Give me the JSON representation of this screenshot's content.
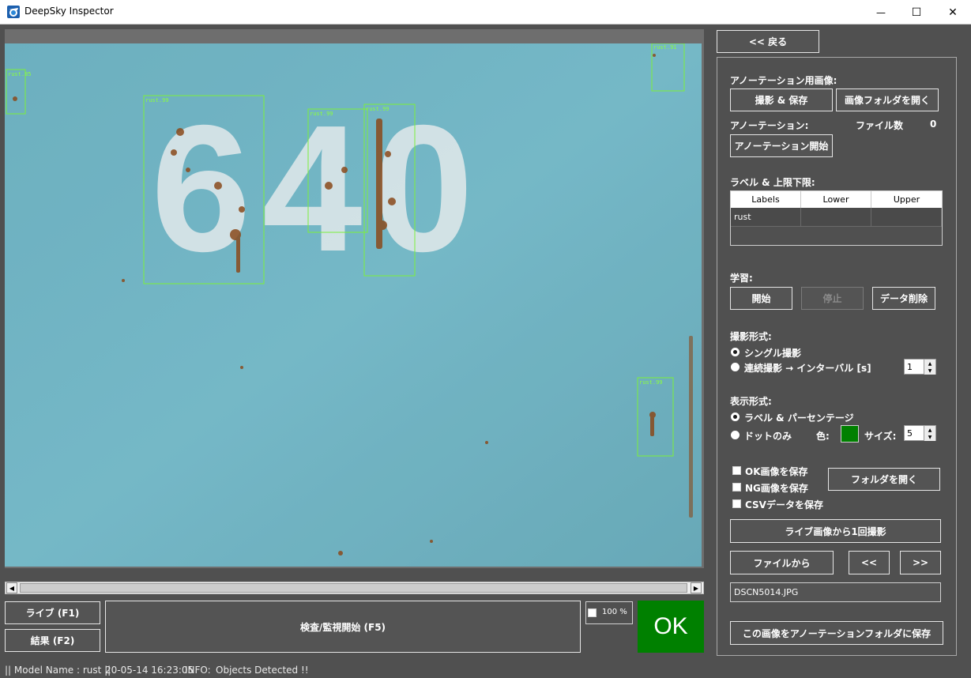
{
  "window": {
    "title": "DeepSky Inspector",
    "minimize_glyph": "—",
    "maximize_glyph": "☐",
    "close_glyph": "✕"
  },
  "viewer": {
    "stencil_number": "640",
    "detections": [
      {
        "label": "rust.85"
      },
      {
        "label": "rust.99"
      },
      {
        "label": "rust.99"
      },
      {
        "label": "rust.99"
      },
      {
        "label": "rust.91"
      },
      {
        "label": "rust.99"
      }
    ]
  },
  "scrollbar": {
    "left_arrow": "◀",
    "right_arrow": "▶"
  },
  "bottom": {
    "live_button": "ライブ (F1)",
    "result_button": "結果 (F2)",
    "start_inspection_button": "検査/監視開始 (F5)",
    "zoom_label": "100 %",
    "status_result": "OK",
    "status_color": "#008000"
  },
  "panel": {
    "back_button": "<< 戻る",
    "annotation_image_heading": "アノーテーション用画像:",
    "capture_save_button": "撮影 & 保存",
    "open_image_folder_button": "画像フォルダを開く",
    "annotation_heading": "アノーテーション:",
    "file_count_label": "ファイル数",
    "file_count_value": "0",
    "start_annotation_button": "アノーテーション開始",
    "label_limits_heading": "ラベル & 上限下限:",
    "table_headers": [
      "Labels",
      "Lower",
      "Upper"
    ],
    "table_rows": [
      [
        "rust",
        "",
        ""
      ]
    ],
    "training_heading": "学習:",
    "train_start_button": "開始",
    "train_stop_button": "停止",
    "delete_data_button": "データ削除",
    "capture_mode_heading": "撮影形式:",
    "single_capture": "シングル撮影",
    "continuous_capture": "連続撮影 → インターバル [s]",
    "interval_value": "1",
    "display_mode_heading": "表示形式:",
    "label_percentage": "ラベル & パーセンテージ",
    "dot_only": "ドットのみ",
    "color_label": "色:",
    "dot_color": "#008000",
    "size_label": "サイズ:",
    "size_value": "5",
    "save_ok_images": "OK画像を保存",
    "save_ng_images": "NG画像を保存",
    "save_csv": "CSVデータを保存",
    "open_folder_button": "フォルダを開く",
    "capture_once_button": "ライブ画像から1回撮影",
    "from_file_button": "ファイルから",
    "prev_button": "<<",
    "next_button": ">>",
    "filename_value": "DSCN5014.JPG",
    "save_to_annotation_button": "この画像をアノーテーションフォルダに保存"
  },
  "statusbar": {
    "model": "|| Model Name : rust ||",
    "timestamp": "20-05-14 16:23:05",
    "info_label": "INFO:",
    "message": "Objects Detected !!"
  }
}
